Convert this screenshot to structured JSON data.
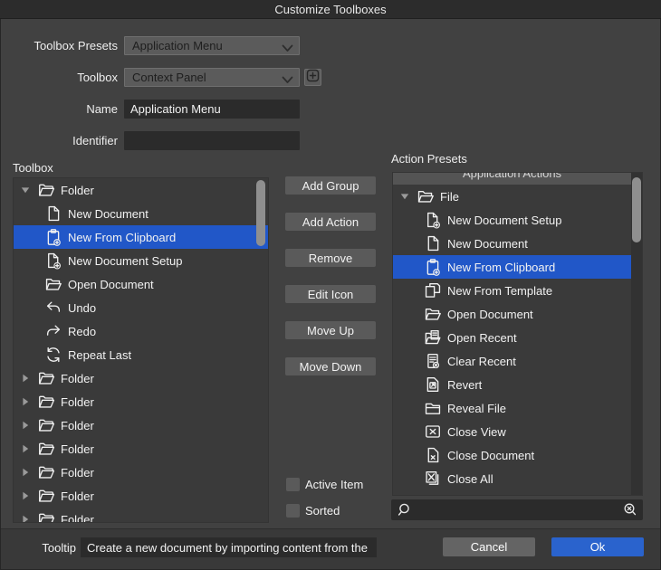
{
  "window": {
    "title": "Customize Toolboxes"
  },
  "form": {
    "preset_label": "Toolbox Presets",
    "preset_value": "Application Menu",
    "toolbox_label": "Toolbox",
    "toolbox_value": "Context Panel",
    "name_label": "Name",
    "name_value": "Application Menu",
    "identifier_label": "Identifier",
    "identifier_value": ""
  },
  "toolbox_panel": {
    "label": "Toolbox",
    "items": [
      {
        "label": "Folder",
        "icon": "folder",
        "level": 0,
        "expander": "expanded"
      },
      {
        "label": "New Document",
        "icon": "document",
        "level": 1
      },
      {
        "label": "New From Clipboard",
        "icon": "clipboard-plus",
        "level": 1,
        "selected": true
      },
      {
        "label": "New Document Setup",
        "icon": "document-plus",
        "level": 1
      },
      {
        "label": "Open Document",
        "icon": "folder-open",
        "level": 1
      },
      {
        "label": "Undo",
        "icon": "undo",
        "level": 1
      },
      {
        "label": "Redo",
        "icon": "redo",
        "level": 1
      },
      {
        "label": "Repeat Last",
        "icon": "repeat",
        "level": 1
      },
      {
        "label": "Folder",
        "icon": "folder",
        "level": 0,
        "expander": "collapsed"
      },
      {
        "label": "Folder",
        "icon": "folder",
        "level": 0,
        "expander": "collapsed"
      },
      {
        "label": "Folder",
        "icon": "folder",
        "level": 0,
        "expander": "collapsed"
      },
      {
        "label": "Folder",
        "icon": "folder",
        "level": 0,
        "expander": "collapsed"
      },
      {
        "label": "Folder",
        "icon": "folder",
        "level": 0,
        "expander": "collapsed"
      },
      {
        "label": "Folder",
        "icon": "folder",
        "level": 0,
        "expander": "collapsed"
      },
      {
        "label": "Folder",
        "icon": "folder",
        "level": 0,
        "expander": "collapsed"
      }
    ]
  },
  "actions": {
    "buttons": [
      {
        "label": "Add Group"
      },
      {
        "label": "Add Action"
      },
      {
        "label": "Remove"
      },
      {
        "label": "Edit Icon"
      },
      {
        "label": "Move Up"
      },
      {
        "label": "Move Down"
      }
    ],
    "checkboxes": [
      {
        "label": "Active Item",
        "checked": false
      },
      {
        "label": "Sorted",
        "checked": false
      }
    ]
  },
  "presets_panel": {
    "label": "Action Presets",
    "group_header": "Application Actions",
    "items": [
      {
        "label": "File",
        "icon": "folder-open",
        "level": 0,
        "expander": "expanded"
      },
      {
        "label": "New Document Setup",
        "icon": "document-plus",
        "level": 1
      },
      {
        "label": "New Document",
        "icon": "document",
        "level": 1
      },
      {
        "label": "New From Clipboard",
        "icon": "clipboard-plus",
        "level": 1,
        "selected": true
      },
      {
        "label": "New From Template",
        "icon": "document-template",
        "level": 1
      },
      {
        "label": "Open Document",
        "icon": "folder-open",
        "level": 1
      },
      {
        "label": "Open Recent",
        "icon": "folder-recent",
        "level": 1
      },
      {
        "label": "Clear Recent",
        "icon": "document-clear",
        "level": 1
      },
      {
        "label": "Revert",
        "icon": "document-revert",
        "level": 1
      },
      {
        "label": "Reveal File",
        "icon": "folder-closed",
        "level": 1
      },
      {
        "label": "Close View",
        "icon": "close-view",
        "level": 1
      },
      {
        "label": "Close Document",
        "icon": "document-close",
        "level": 1
      },
      {
        "label": "Close All",
        "icon": "close-all",
        "level": 1
      }
    ],
    "search": {
      "value": ""
    }
  },
  "footer": {
    "tooltip_label": "Tooltip",
    "tooltip_value": "Create a new document by importing content from the clipbo",
    "cancel_label": "Cancel",
    "ok_label": "Ok"
  },
  "colors": {
    "selection": "#2157c8",
    "ok_button": "#2a63cd",
    "titlebar": "#2c2c2c",
    "panel": "#3a3a3a"
  }
}
